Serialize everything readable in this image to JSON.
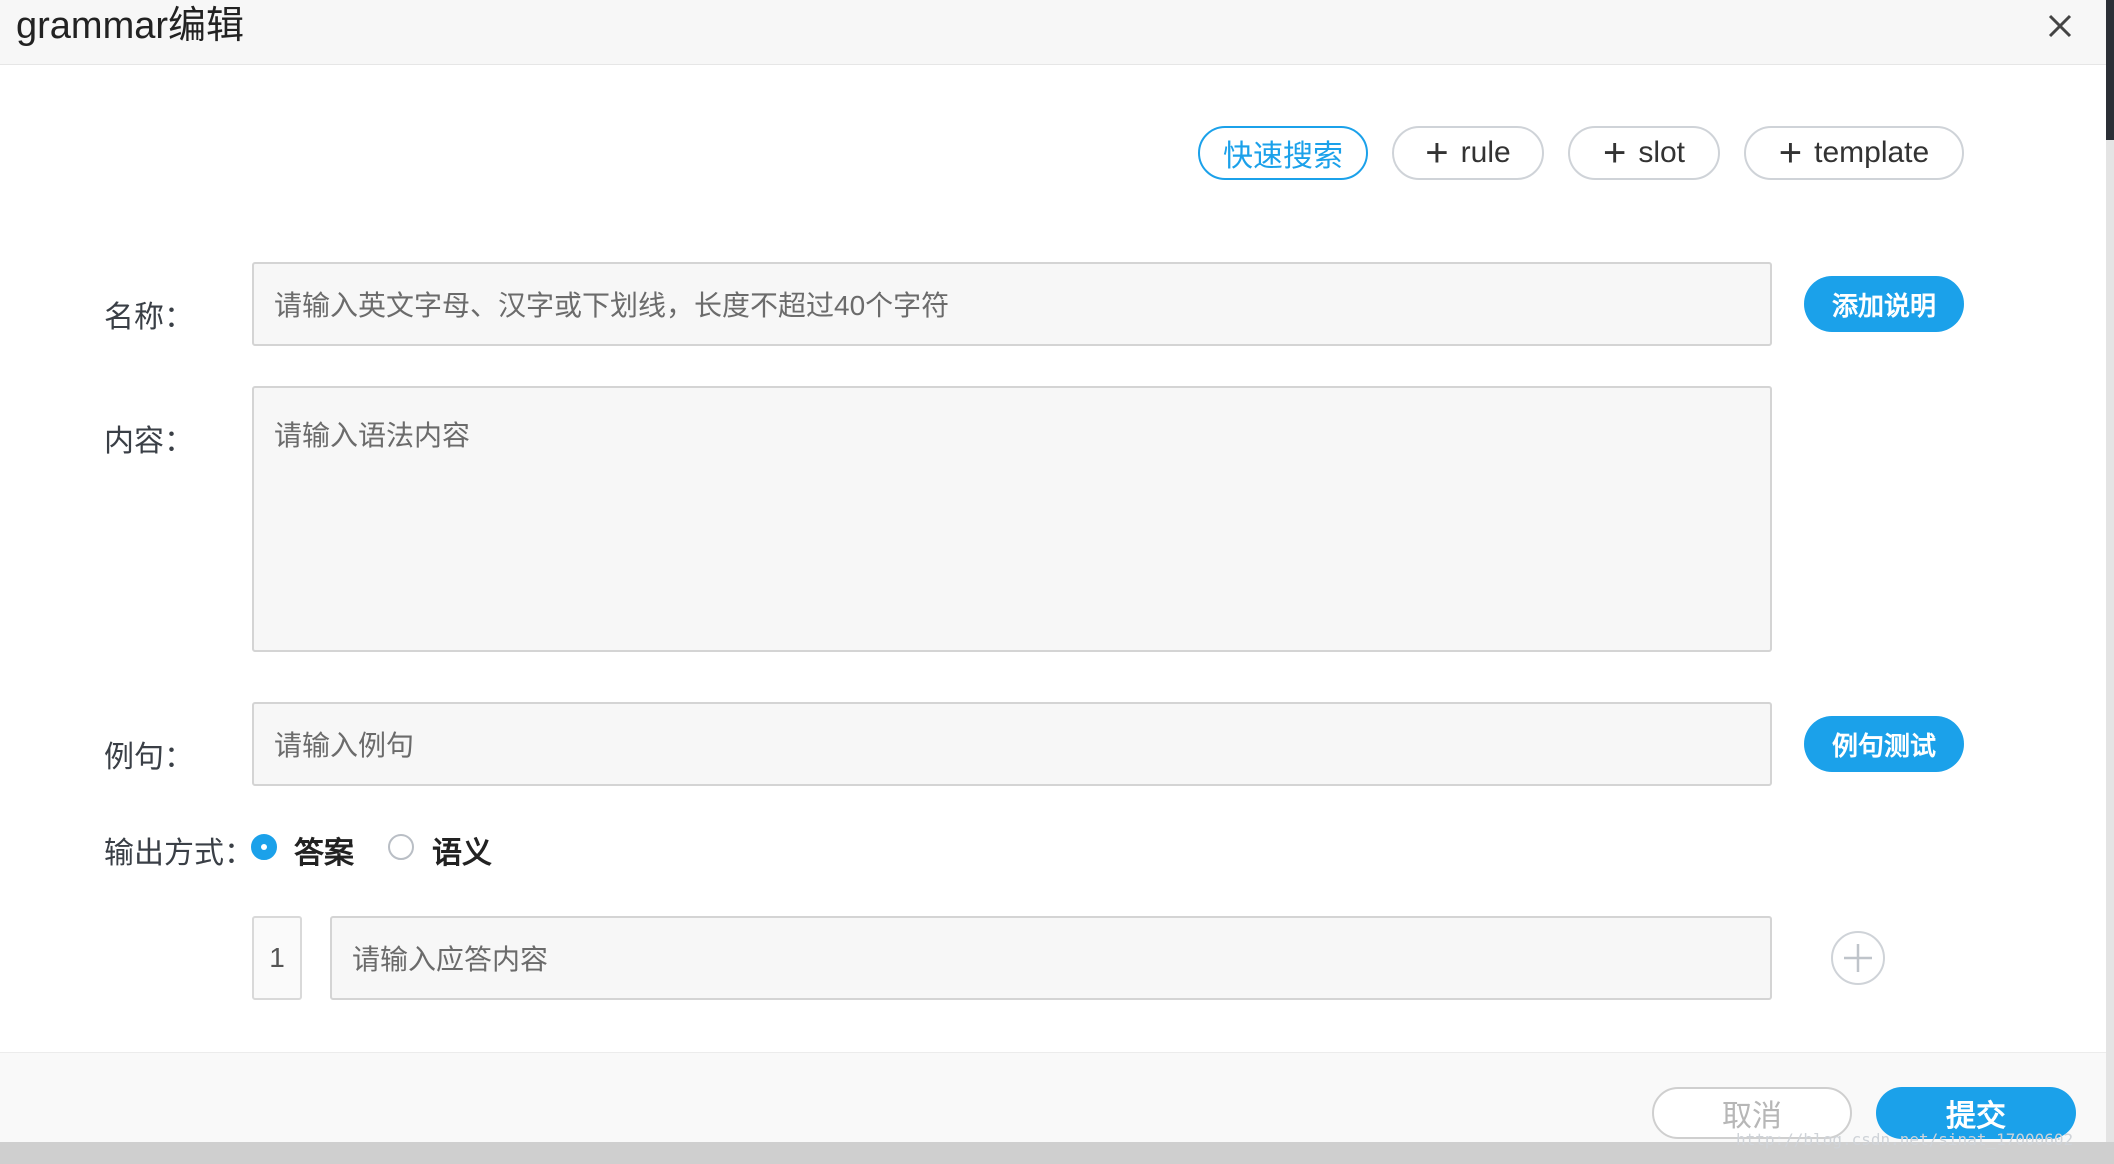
{
  "dialog": {
    "title": "grammar编辑"
  },
  "toolbar": {
    "search_label": "快速搜索",
    "rule_label": "rule",
    "slot_label": "slot",
    "template_label": "template"
  },
  "form": {
    "name": {
      "label": "名称：",
      "placeholder": "请输入英文字母、汉字或下划线，长度不超过40个字符",
      "action_label": "添加说明"
    },
    "content": {
      "label": "内容：",
      "placeholder": "请输入语法内容"
    },
    "example": {
      "label": "例句：",
      "placeholder": "请输入例句",
      "action_label": "例句测试"
    },
    "output": {
      "label": "输出方式：",
      "options": [
        {
          "label": "答案",
          "selected": true
        },
        {
          "label": "语义",
          "selected": false
        }
      ]
    },
    "answers": [
      {
        "index": "1",
        "placeholder": "请输入应答内容"
      }
    ]
  },
  "footer": {
    "cancel_label": "取消",
    "submit_label": "提交"
  },
  "watermark": "http://blog.csdn.net/sinat_17000602",
  "colors": {
    "accent": "#1ba1ea",
    "input_bg": "#f7f7f7",
    "border": "#d4d4d4"
  },
  "icons": [
    "close-icon",
    "plus-icon",
    "add-circle-icon",
    "radio-checked-icon",
    "radio-unchecked-icon"
  ]
}
